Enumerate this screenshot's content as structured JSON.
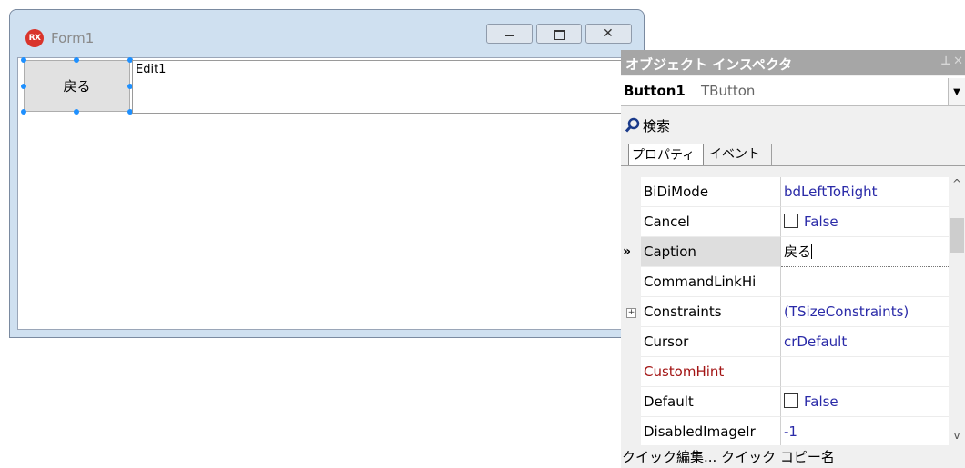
{
  "form": {
    "app_icon_text": "RX",
    "title": "Form1",
    "button_caption": "戻る",
    "edit_text": "Edit1",
    "window_buttons": {
      "minimize_icon": "minimize-icon",
      "maximize_icon": "maximize-icon",
      "close_icon": "close-icon"
    }
  },
  "inspector": {
    "title": "オブジェクト インスペクタ",
    "component_name": "Button1",
    "component_type": "TButton",
    "search_label": "検索",
    "tabs": {
      "properties": "プロパティ",
      "events": "イベント"
    },
    "rows": [
      {
        "name": "BiDiMode",
        "value": "bdLeftToRight"
      },
      {
        "name": "Cancel",
        "value": "False"
      },
      {
        "name": "Caption",
        "value": "戻る",
        "marker": "»"
      },
      {
        "name": "CommandLinkHi",
        "value": ""
      },
      {
        "name": "Constraints",
        "value": "(TSizeConstraints)",
        "expander": "+"
      },
      {
        "name": "Cursor",
        "value": "crDefault"
      },
      {
        "name": "CustomHint",
        "value": ""
      },
      {
        "name": "Default",
        "value": "False"
      },
      {
        "name": "DisabledImageIr",
        "value": "-1"
      }
    ],
    "footer": "クイック編集... クイック コピー名",
    "colors": {
      "value_blue": "#2a2aa8",
      "highlight_red": "#a31515",
      "header_gray": "#a6a6a6"
    }
  }
}
